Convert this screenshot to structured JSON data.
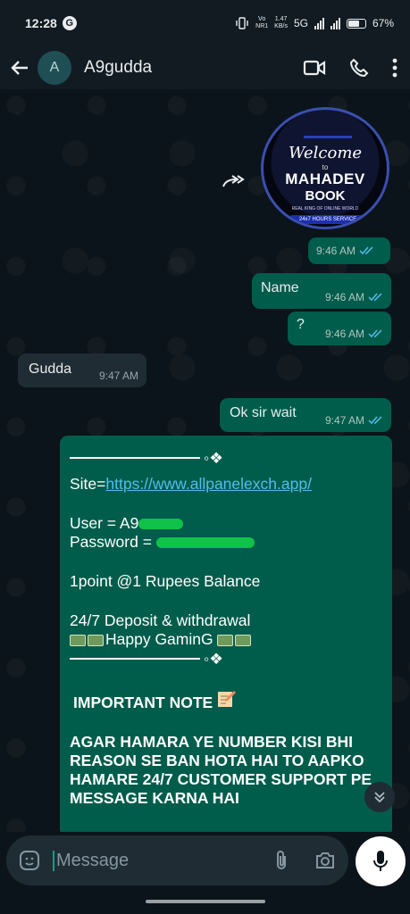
{
  "status": {
    "time": "12:28",
    "vo_top": "Vo",
    "vo_bottom": "NR1",
    "speed_top": "1.47",
    "speed_bottom": "KB/s",
    "network": "5G",
    "battery": "67%"
  },
  "header": {
    "avatar_letter": "A",
    "contact_name": "A9gudda"
  },
  "media": {
    "line1": "Welcome",
    "line2": "to",
    "line3": "MAHADEV",
    "line4": "BOOK",
    "tagline": "REAL KING OF ONLINE WORLD",
    "service": "24x7 HOURS SERVICE",
    "time": "9:46 AM"
  },
  "messages": {
    "m1_time": "9:46 AM",
    "m2_text": "Name",
    "m2_time": "9:46 AM",
    "m3_text": "?",
    "m3_time": "9:46 AM",
    "m4_text": "Gudda",
    "m4_time": "9:47 AM",
    "m5_text": "Ok sir wait",
    "m5_time": "9:47 AM"
  },
  "main_message": {
    "divider_end": "◦❖",
    "site_prefix": "Site=",
    "site_link": "https://www.allpanelexch.app/",
    "user_label": "User = A9",
    "password_label": "Password = ",
    "points": "1point @1 Rupees Balance",
    "deposit": "24/7 Deposit & withdrawal",
    "happy": "Happy GaminG",
    "note_title": "IMPORTANT NOTE",
    "note_body": "AGAR HAMARA YE NUMBER KISI BHI REASON SE BAN HOTA HAI TO AAPKO HAMARE 24/7 CUSTOMER SUPPORT PE MESSAGE KARNA HAI"
  },
  "composer": {
    "placeholder": "Message"
  },
  "colors": {
    "outgoing": "#005c4b",
    "incoming": "#202c33",
    "accent": "#00a884",
    "tick": "#53bdeb"
  }
}
